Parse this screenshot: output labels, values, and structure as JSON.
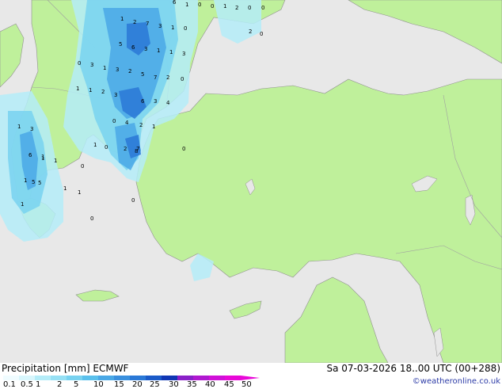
{
  "map": {
    "colors": {
      "sea": "#e8e8e8",
      "land": "#bff09b",
      "borders": "#a0a0a0",
      "coast": "#909090",
      "precip_light": "#b4ecf8",
      "precip_mid": "#78d2f0",
      "precip_heavy": "#4aa8e6",
      "precip_max": "#2a78d6"
    },
    "point_values": [
      "6",
      "1",
      "0",
      "0",
      "1",
      "2",
      "0",
      "1",
      "2",
      "7",
      "3",
      "1",
      "0",
      "5",
      "6",
      "3",
      "1",
      "1",
      "3",
      "0",
      "3",
      "1",
      "3",
      "2",
      "5",
      "7",
      "2",
      "0",
      "1",
      "1",
      "2",
      "3",
      "6",
      "3",
      "4",
      "0",
      "4",
      "2",
      "1",
      "3",
      "8",
      "7",
      "1",
      "6",
      "5",
      "1",
      "1",
      "0",
      "0",
      "2",
      "1",
      "1",
      "1",
      "1",
      "5",
      "1",
      "0",
      "0",
      "1",
      "2",
      "0",
      "0",
      "0"
    ]
  },
  "legend": {
    "title": "Precipitation [mm]  ECMWF",
    "valid": "Sa 07-03-2026 18..00 UTC (00+288)",
    "credit": "©weatheronline.co.uk",
    "ticks": [
      "0.1",
      "0.5",
      "1",
      "2",
      "5",
      "10",
      "15",
      "20",
      "25",
      "30",
      "35",
      "40",
      "45",
      "50"
    ],
    "colors": [
      "#f0fcff",
      "#d8f6fc",
      "#b4ecf8",
      "#96e0f4",
      "#78d2f0",
      "#5ac0ec",
      "#4aa8e6",
      "#3a90de",
      "#2a78d6",
      "#1a5ac8",
      "#1036b4",
      "#8a20c8",
      "#b018d0",
      "#d010d8",
      "#e808d8"
    ]
  }
}
